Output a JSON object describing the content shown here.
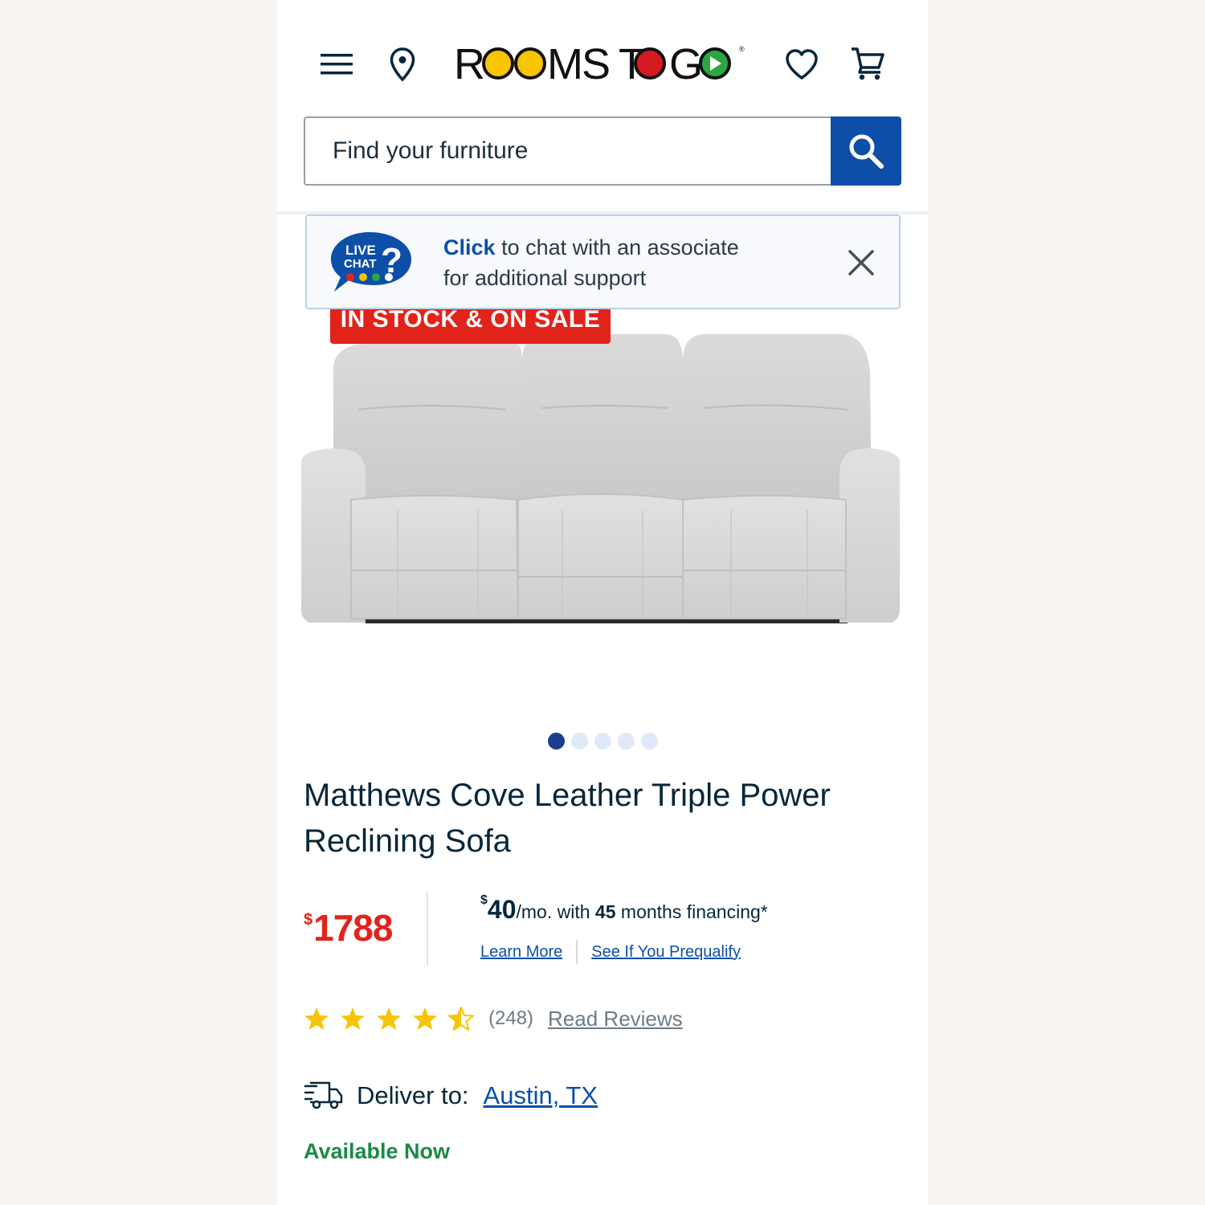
{
  "header": {
    "logo_text": "ROOMS TO GO",
    "icons": [
      "menu-icon",
      "location-pin-icon",
      "heart-icon",
      "cart-icon"
    ]
  },
  "search": {
    "placeholder": "Find your furniture",
    "icon": "search-icon"
  },
  "chat_banner": {
    "logo_line1": "LIVE",
    "logo_line2": "CHAT",
    "click_label": "Click",
    "text_rest": "to chat with an associate",
    "text_line2": "for additional support"
  },
  "product": {
    "badge": "IN STOCK & ON SALE",
    "title": "Matthews Cove Leather Triple Power Reclining Sofa",
    "image_count": 5,
    "active_image": 1,
    "price_currency": "$",
    "price": "1788",
    "financing": {
      "currency": "$",
      "amount": "40",
      "per": "/mo. with",
      "months": "45",
      "suffix": "months financing*"
    },
    "links": {
      "learn_more": "Learn More",
      "prequalify": "See If You Prequalify"
    },
    "rating": {
      "stars": 4.5,
      "count": "(248)",
      "reviews_link": "Read Reviews"
    },
    "delivery": {
      "label": "Deliver to:",
      "city": "Austin, TX"
    },
    "availability": "Available Now"
  },
  "colors": {
    "brand_blue": "#0d4fa8",
    "sale_red": "#e2231a",
    "available_green": "#1a8a45",
    "star_yellow": "#f7c400"
  }
}
